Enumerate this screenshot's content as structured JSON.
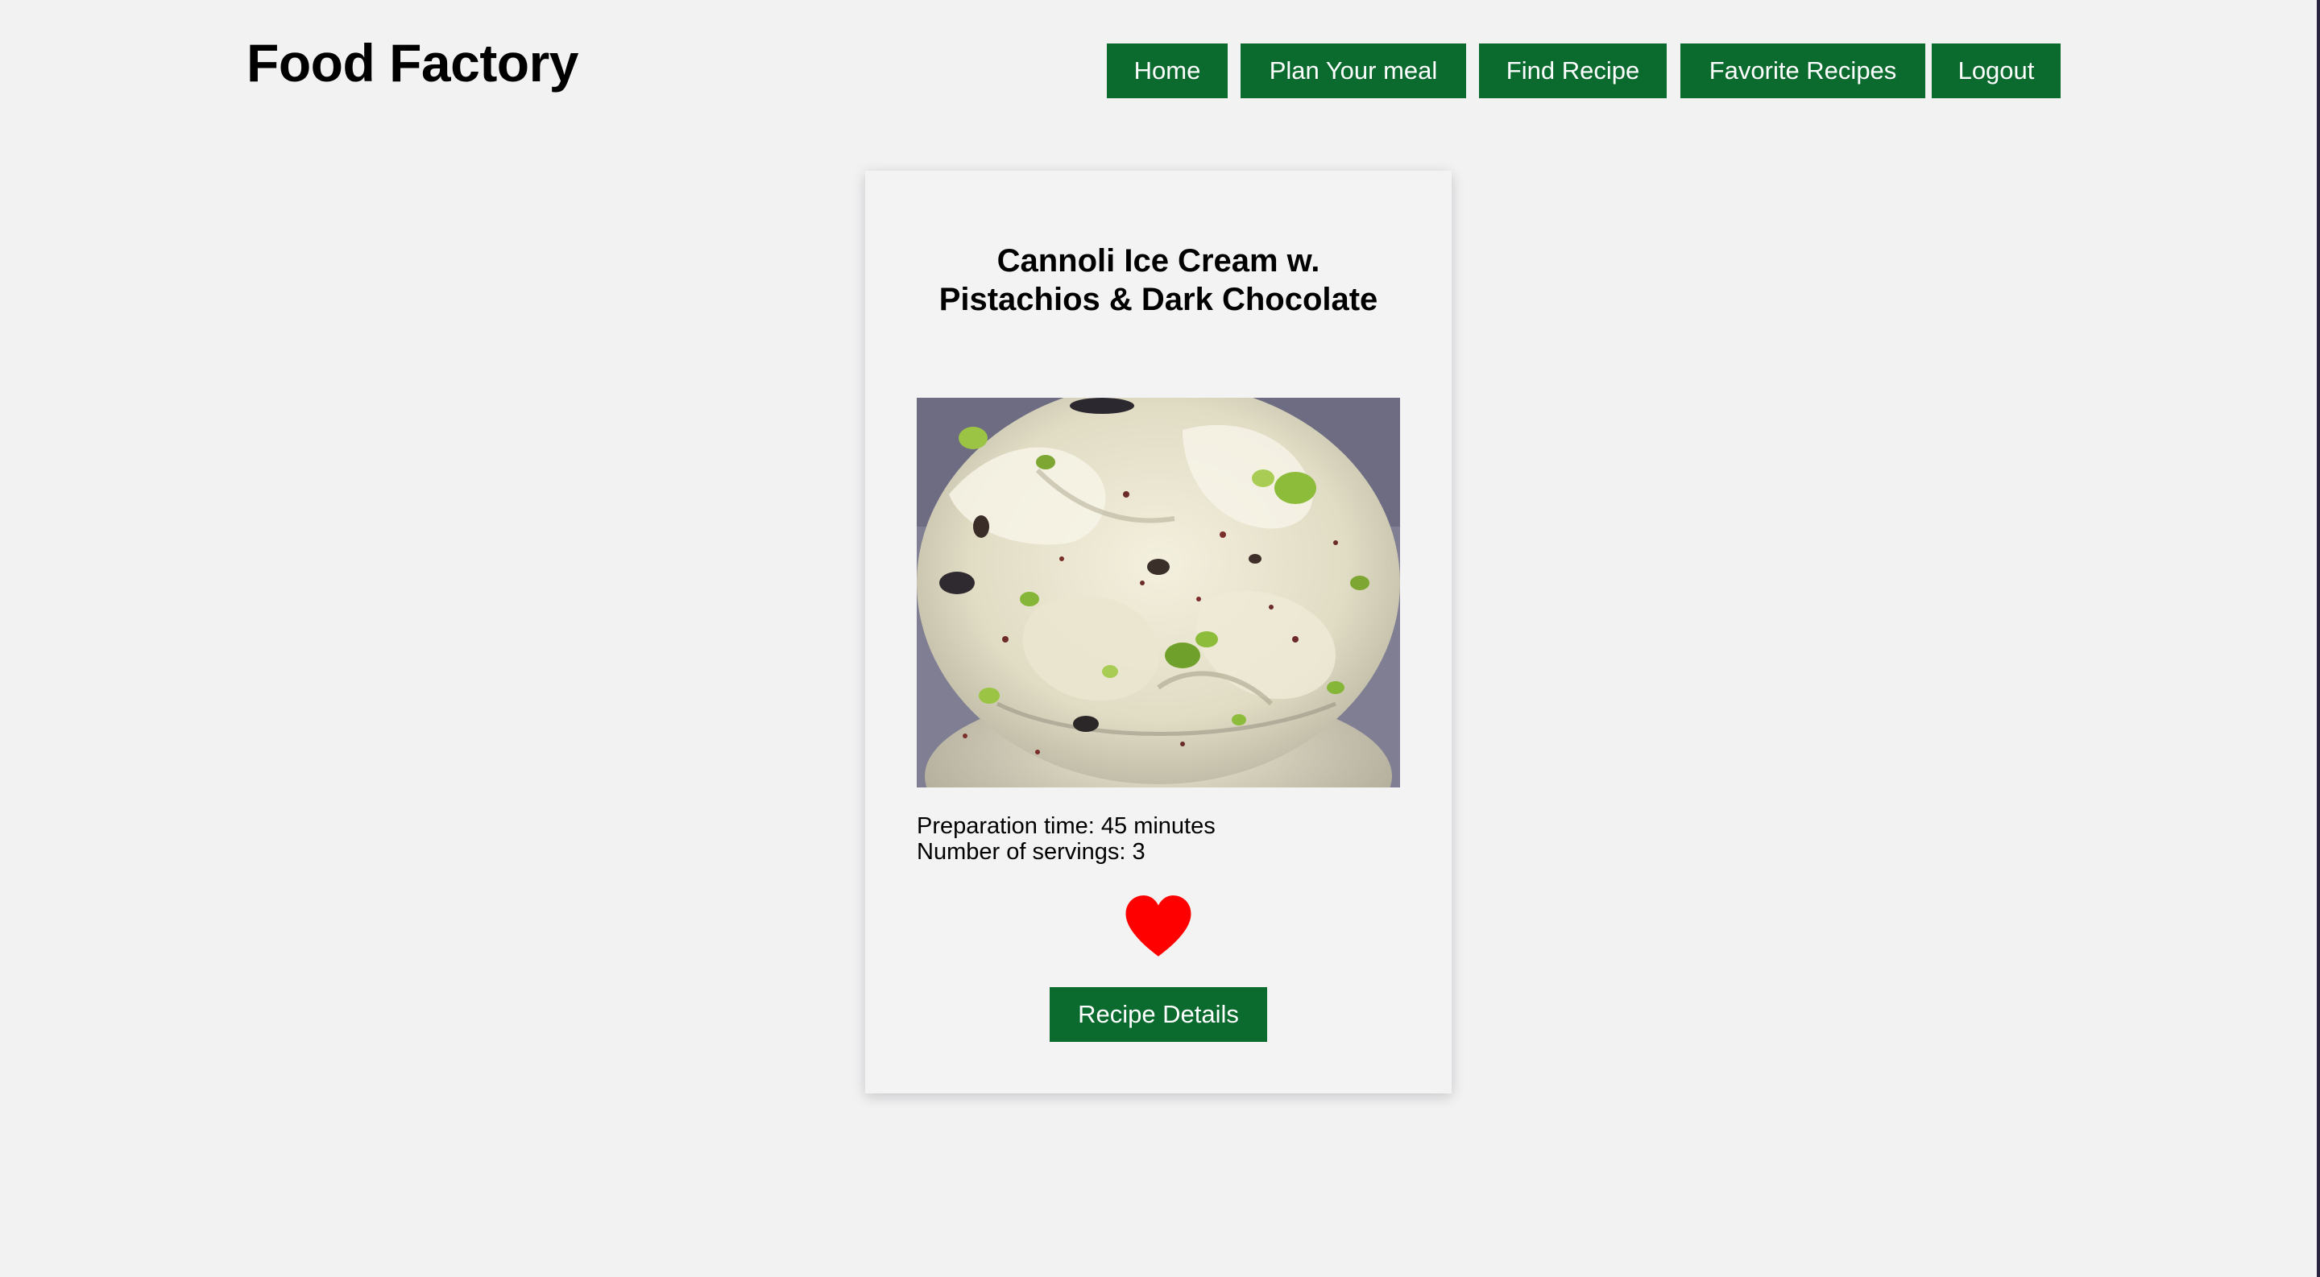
{
  "header": {
    "logo_text": "Food Factory"
  },
  "nav": {
    "items": [
      {
        "label": "Home"
      },
      {
        "label": "Plan Your meal"
      },
      {
        "label": "Find Recipe"
      },
      {
        "label": "Favorite Recipes"
      },
      {
        "label": "Logout"
      }
    ]
  },
  "recipe": {
    "title": "Cannoli Ice Cream w. Pistachios & Dark Chocolate",
    "image_icon": "ice-cream-photo",
    "prep_time_text": "Preparation time: 45 minutes",
    "servings_text": "Number of servings: 3",
    "favorite_icon": "heart-icon",
    "favorited": true,
    "details_button_label": "Recipe Details"
  },
  "colors": {
    "page_background": "#f2f2f3",
    "card_background": "#f3f3f3",
    "button_green": "#0b6b2f",
    "button_text": "#ffffff",
    "heart_red": "#ff0000"
  }
}
